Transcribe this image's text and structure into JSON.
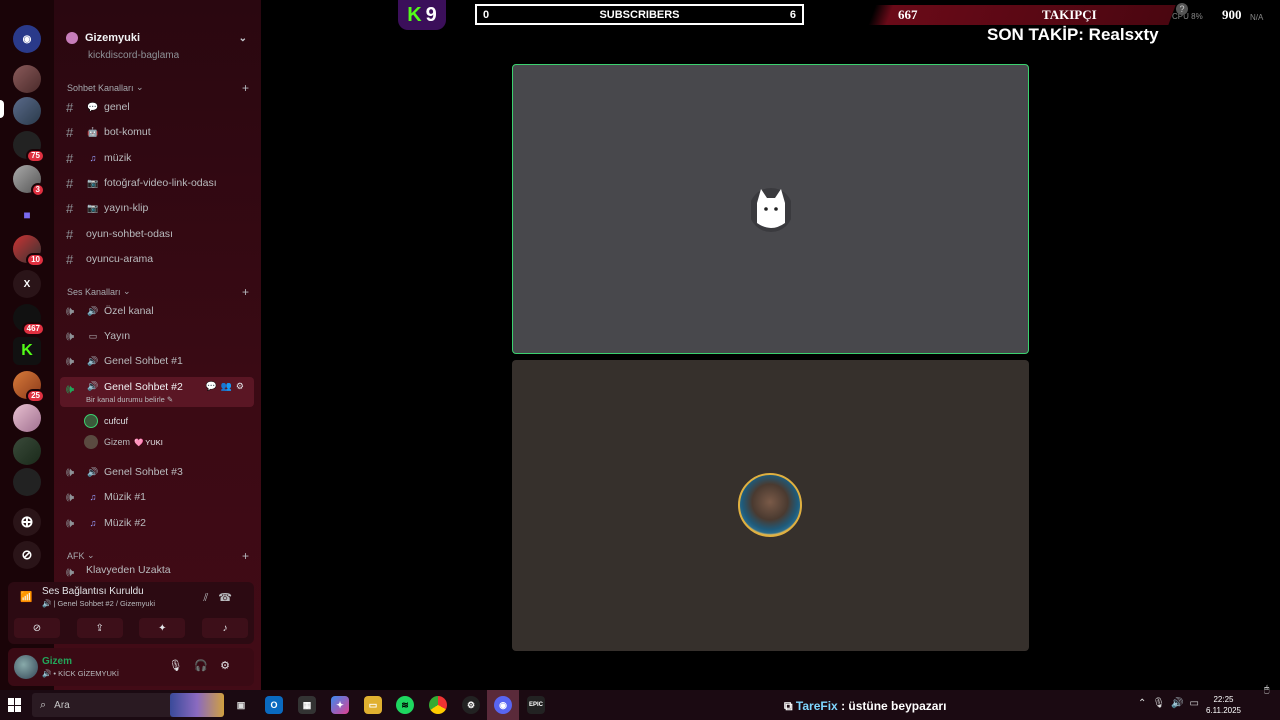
{
  "overlay": {
    "kick_count": "9",
    "subs": {
      "left": "0",
      "label": "SUBSCRIBERS",
      "right": "6"
    },
    "followers": {
      "count": "667",
      "label": "TAKIPÇI",
      "goal": "900"
    },
    "last_follow": "SON TAKİP: Realsxty",
    "cpu": "CPU  8%",
    "np": "N/A"
  },
  "server": {
    "name": "Gizemyuki",
    "clipped_channel": "kickdiscord-baglama"
  },
  "rail": {
    "badges": [
      "75",
      "3",
      "10",
      "467",
      "25"
    ],
    "x_label": "X"
  },
  "categories": {
    "chat": "Sohbet Kanalları",
    "voice": "Ses Kanalları",
    "afk": "AFK"
  },
  "text_channels": [
    {
      "name": "genel",
      "emoji": "💬"
    },
    {
      "name": "bot-komut",
      "emoji": "🤖"
    },
    {
      "name": "müzik",
      "emoji": "♫"
    },
    {
      "name": "fotoğraf-video-link-odası",
      "emoji": "📷"
    },
    {
      "name": "yayın-klip",
      "emoji": "📷"
    },
    {
      "name": "oyun-sohbet-odası",
      "emoji": ""
    },
    {
      "name": "oyuncu-arama",
      "emoji": ""
    }
  ],
  "voice_channels": [
    {
      "name": "Özel kanal",
      "emoji": "🔊"
    },
    {
      "name": "Yayın",
      "emoji": "▭"
    },
    {
      "name": "Genel Sohbet #1",
      "emoji": "🔊"
    },
    {
      "name": "Genel Sohbet #2",
      "emoji": "🔊",
      "status": "Bir kanal durumu belirle ✎"
    },
    {
      "name": "Genel Sohbet #3",
      "emoji": "🔊"
    },
    {
      "name": "Müzik #1",
      "emoji": "♫"
    },
    {
      "name": "Müzik #2",
      "emoji": "♫"
    }
  ],
  "voice_users": [
    {
      "name": "cufcuf",
      "tag": ""
    },
    {
      "name": "Gizem",
      "tag": "🩷 YUKI"
    }
  ],
  "afk_channels": [
    {
      "name": "Klavyeden Uzakta"
    }
  ],
  "voice_panel": {
    "status": "Ses Bağlantısı Kuruldu",
    "channel": "🔊 | Genel Sohbet #2 / Gizemyuki"
  },
  "user_panel": {
    "name": "Gizem",
    "status": "🔊 • KİCK GİZEMYUKİ"
  },
  "taskbar": {
    "search_placeholder": "Ara",
    "tarefix_brand": "TareFix",
    "tarefix_text": ": üstüne beypazarı",
    "time": "22:25",
    "date": "6.11.2025"
  },
  "colors": {
    "speaking_border": "#3bd16f",
    "kick_green": "#53fc18",
    "accent_red": "#6a0a18"
  }
}
